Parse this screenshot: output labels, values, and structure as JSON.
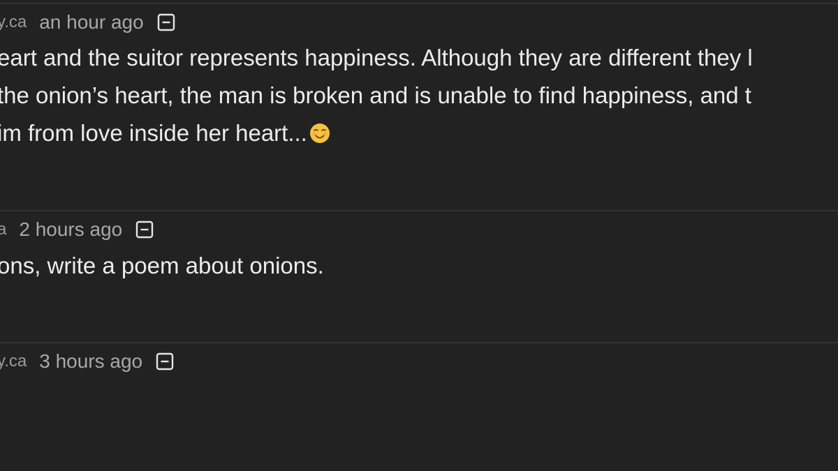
{
  "comments": [
    {
      "author": "y.ca",
      "time": "an hour ago",
      "collapse_icon": "minus-square-icon",
      "lines": [
        "eart and the suitor represents happiness. Although they are different they l",
        " the onion’s heart, the man is broken and is unable to find happiness, and t",
        "im from love inside her heart..."
      ],
      "emoji": "smiling-face-icon"
    },
    {
      "author": "a",
      "time": "2 hours ago",
      "collapse_icon": "minus-square-icon",
      "lines": [
        "ons, write a poem about onions."
      ]
    },
    {
      "author": "y.ca",
      "time": "3 hours ago",
      "collapse_icon": "minus-square-icon",
      "lines": []
    }
  ],
  "colors": {
    "background": "#222222",
    "divider": "#333333",
    "text": "#ececec",
    "meta": "#a8a8a8"
  }
}
